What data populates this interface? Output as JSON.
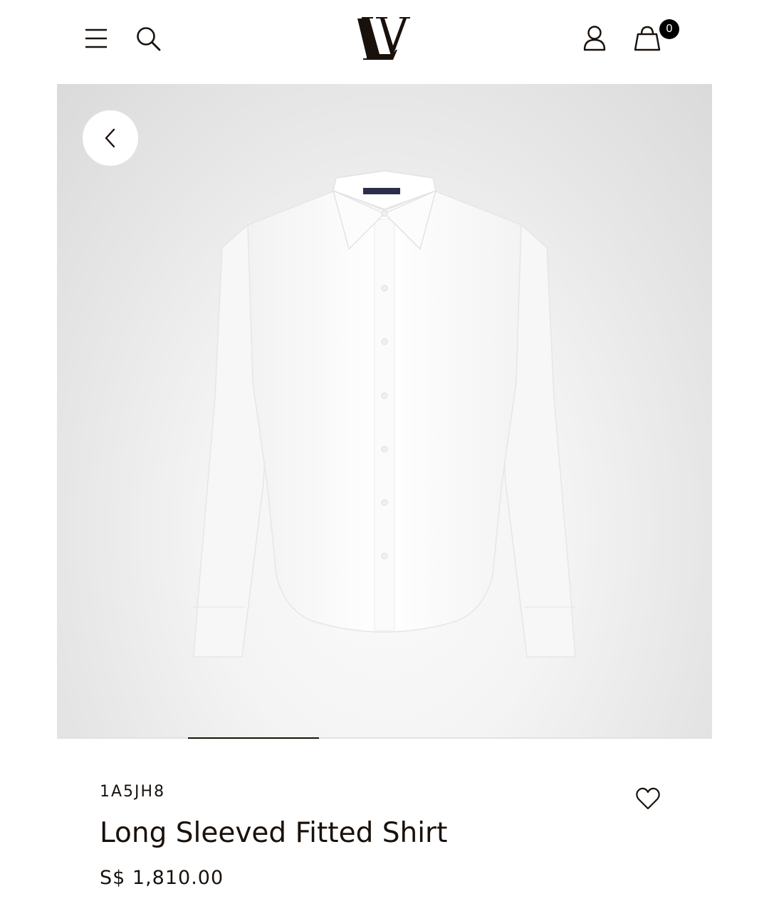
{
  "header": {
    "menu_icon": "hamburger-menu-icon",
    "search_icon": "search-icon",
    "logo_text": "LV",
    "account_icon": "user-icon",
    "bag_icon": "shopping-bag-icon",
    "bag_count": "0"
  },
  "gallery": {
    "back_icon": "chevron-left-icon",
    "image": "white-long-sleeve-shirt",
    "progress": 0.2,
    "background_color": "#f2f2f2"
  },
  "product": {
    "sku": "1A5JH8",
    "name": "Long Sleeved Fitted Shirt",
    "price": "S$ 1,810.00",
    "wishlist_icon": "heart-icon"
  },
  "colors": {
    "text": "#19110b",
    "badge": "#000000",
    "background": "#ffffff"
  }
}
